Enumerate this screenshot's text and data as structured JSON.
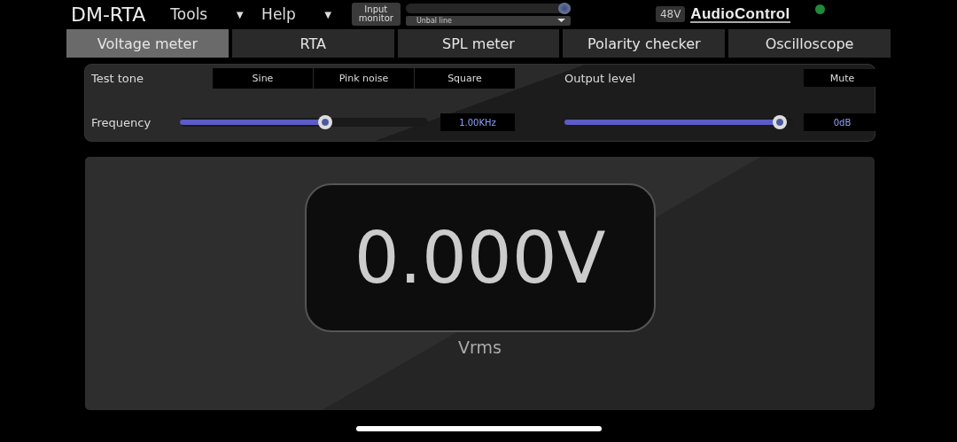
{
  "app_title": "DM-RTA",
  "menus": [
    {
      "label": "Tools",
      "caret": "▼"
    },
    {
      "label": "Help",
      "caret": "▼"
    }
  ],
  "input_monitor": {
    "label": "Input\nmonitor",
    "level": 1,
    "source": "Unbal line"
  },
  "phantom_badge": "48V",
  "logo": "AudioControl",
  "status_led": {
    "on": true,
    "color": "#1f8a3a"
  },
  "tabs": [
    {
      "label": "Voltage meter",
      "selected": true
    },
    {
      "label": "RTA",
      "selected": false
    },
    {
      "label": "SPL meter",
      "selected": false
    },
    {
      "label": "Polarity checker",
      "selected": false
    },
    {
      "label": "Oscilloscope",
      "selected": false
    }
  ],
  "generator": {
    "test_tone_label": "Test tone",
    "tones": [
      "Sine",
      "Pink noise",
      "Square"
    ],
    "output_label": "Output level",
    "mute": "Mute",
    "frequency_label": "Frequency",
    "frequency_slider": {
      "level": 0.59
    },
    "frequency_value": "1.00KHz",
    "output_slider": {
      "level": 0.97
    },
    "output_value": "0dB"
  },
  "meter": {
    "reading": "0.000V",
    "unit": "Vrms"
  }
}
